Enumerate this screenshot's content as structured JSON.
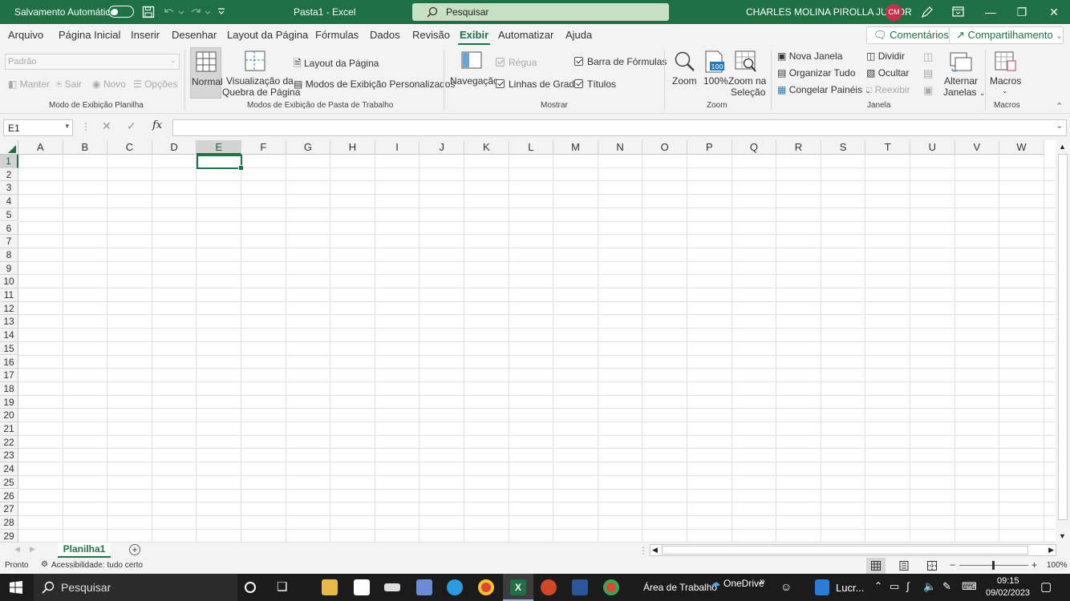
{
  "titlebar": {
    "autosave_label": "Salvamento Automático",
    "file_title": "Pasta1  -  Excel",
    "search_placeholder": "Pesquisar",
    "user_name": "CHARLES MOLINA PIROLLA JUNIOR",
    "user_initials": "CM",
    "bg_color": "#1f7145"
  },
  "tabs": [
    "Arquivo",
    "Página Inicial",
    "Inserir",
    "Desenhar",
    "Layout da Página",
    "Fórmulas",
    "Dados",
    "Revisão",
    "Exibir",
    "Automatizar",
    "Ajuda"
  ],
  "active_tab": "Exibir",
  "top_buttons": {
    "comments": "Comentários",
    "share": "Compartilhamento"
  },
  "ribbon": {
    "sheet_view": {
      "dropdown": "Padrão",
      "keep": "Manter",
      "exit": "Sair",
      "new": "Novo",
      "options": "Opções",
      "group": "Modo de Exibição Planilha"
    },
    "workbook_views": {
      "normal": "Normal",
      "page_break_1": "Visualização da",
      "page_break_2": "Quebra de Página",
      "page_layout": "Layout da Página",
      "custom_views": "Modos de Exibição Personalizados",
      "group": "Modos de Exibição de Pasta de Trabalho"
    },
    "show": {
      "navigation": "Navegação",
      "ruler": "Régua",
      "gridlines": "Linhas de Grade",
      "formula_bar": "Barra de Fórmulas",
      "headings": "Títulos",
      "group": "Mostrar"
    },
    "zoom": {
      "zoom": "Zoom",
      "hundred": "100%",
      "zoom_sel_1": "Zoom na",
      "zoom_sel_2": "Seleção",
      "group": "Zoom"
    },
    "window": {
      "new_window": "Nova Janela",
      "arrange_all": "Organizar Tudo",
      "freeze_panes": "Congelar Painéis",
      "split": "Dividir",
      "hide": "Ocultar",
      "unhide": "Reexibir",
      "switch_1": "Alternar",
      "switch_2": "Janelas",
      "group": "Janela"
    },
    "macros": {
      "macros": "Macros",
      "group": "Macros"
    }
  },
  "formula_bar": {
    "name_box": "E1",
    "fx": "fx",
    "value": ""
  },
  "grid": {
    "columns": [
      "A",
      "B",
      "C",
      "D",
      "E",
      "F",
      "G",
      "H",
      "I",
      "J",
      "K",
      "L",
      "M",
      "N",
      "O",
      "P",
      "Q",
      "R",
      "S",
      "T",
      "U",
      "V",
      "W"
    ],
    "rows": [
      "1",
      "2",
      "3",
      "4",
      "5",
      "6",
      "7",
      "8",
      "9",
      "10",
      "11",
      "12",
      "13",
      "14",
      "15",
      "16",
      "17",
      "18",
      "19",
      "20",
      "21",
      "22",
      "23",
      "24",
      "25",
      "26",
      "27",
      "28",
      "29"
    ],
    "selected_column": "E",
    "selected_row": "1",
    "accent_color": "#1f7145"
  },
  "sheets": [
    "Planilha1"
  ],
  "status": {
    "ready": "Pronto",
    "accessibility": "Acessibilidade: tudo certo",
    "zoom": "100%"
  },
  "taskbar": {
    "search": "Pesquisar",
    "desktop": "Área de Trabalho",
    "onedrive": "OneDrive",
    "app": "Lucr...",
    "time": "09:15",
    "date": "09/02/2023"
  }
}
